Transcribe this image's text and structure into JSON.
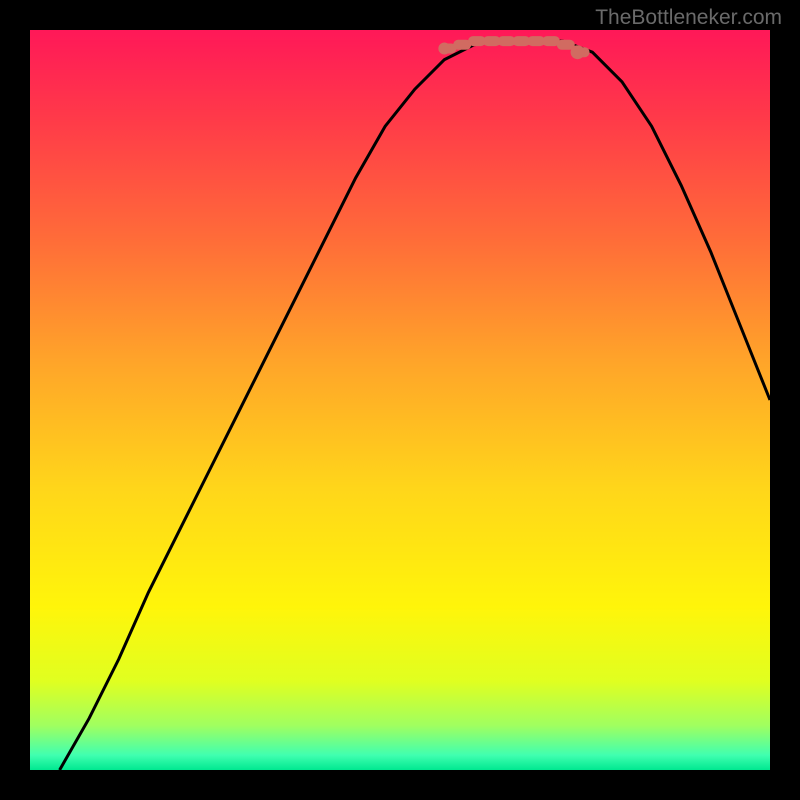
{
  "watermark": "TheBottleneker.com",
  "chart_data": {
    "type": "line",
    "title": "",
    "xlabel": "",
    "ylabel": "",
    "xlim": [
      0,
      1
    ],
    "ylim": [
      0,
      1
    ],
    "background_gradient": {
      "stops": [
        {
          "offset": 0.0,
          "color": "#ff1858"
        },
        {
          "offset": 0.12,
          "color": "#ff3a49"
        },
        {
          "offset": 0.28,
          "color": "#ff6b39"
        },
        {
          "offset": 0.45,
          "color": "#ffa529"
        },
        {
          "offset": 0.62,
          "color": "#ffd61a"
        },
        {
          "offset": 0.78,
          "color": "#fff50a"
        },
        {
          "offset": 0.88,
          "color": "#e0ff20"
        },
        {
          "offset": 0.94,
          "color": "#a0ff60"
        },
        {
          "offset": 0.98,
          "color": "#40ffb0"
        },
        {
          "offset": 1.0,
          "color": "#00e890"
        }
      ]
    },
    "series": [
      {
        "name": "curve",
        "color": "#000000",
        "x": [
          0.04,
          0.08,
          0.12,
          0.16,
          0.2,
          0.24,
          0.28,
          0.32,
          0.36,
          0.4,
          0.44,
          0.48,
          0.52,
          0.56,
          0.6,
          0.64,
          0.68,
          0.72,
          0.76,
          0.8,
          0.84,
          0.88,
          0.92,
          0.96,
          1.0
        ],
        "y": [
          0.0,
          0.07,
          0.15,
          0.24,
          0.32,
          0.4,
          0.48,
          0.56,
          0.64,
          0.72,
          0.8,
          0.87,
          0.92,
          0.96,
          0.98,
          0.985,
          0.985,
          0.985,
          0.97,
          0.93,
          0.87,
          0.79,
          0.7,
          0.6,
          0.5
        ]
      },
      {
        "name": "optimal-segment",
        "color": "#d16b61",
        "style": "thick-dotted",
        "x": [
          0.56,
          0.58,
          0.6,
          0.62,
          0.64,
          0.66,
          0.68,
          0.7,
          0.72,
          0.74
        ],
        "y": [
          0.975,
          0.98,
          0.985,
          0.985,
          0.985,
          0.985,
          0.985,
          0.985,
          0.98,
          0.97
        ]
      }
    ],
    "markers": [
      {
        "name": "start-dot",
        "x": 0.56,
        "y": 0.975,
        "r": 6,
        "color": "#d16b61"
      },
      {
        "name": "end-dot",
        "x": 0.74,
        "y": 0.97,
        "r": 7,
        "color": "#d16b61"
      }
    ]
  }
}
